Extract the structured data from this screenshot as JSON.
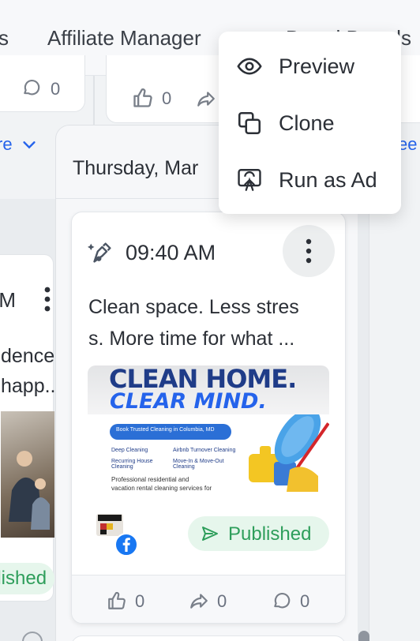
{
  "nav": {
    "left_fragment": "s",
    "affiliate_manager": "Affiliate Manager",
    "right_fragment": "Brand Boards"
  },
  "left_card": {
    "comment_count": "0",
    "see_more_fragment": "re",
    "time_fragment": "AM",
    "text_line1": "dence",
    "text_line2": "happ...",
    "status_fragment": "blished"
  },
  "middle_card": {
    "like_count": "0"
  },
  "right_fragment": "ee",
  "column": {
    "date_header": "Thursday, Mar"
  },
  "post": {
    "time": "09:40 AM",
    "caption_line1": "Clean space. Less stres",
    "caption_line2": "s. More time for what ...",
    "status": "Published",
    "like_count": "0",
    "share_count": "0",
    "comment_count": "0",
    "image": {
      "headline1": "CLEAN HOME.",
      "headline2": "CLEAR MIND.",
      "banner": "Book Trusted Cleaning in Columbia, MD",
      "services": [
        "Deep Cleaning",
        "Airbnb Turnover Cleaning",
        "Recurring House Cleaning",
        "Move-In & Move-Out Cleaning"
      ],
      "footer_line1": "Professional residential and",
      "footer_line2": "vacation rental cleaning services for"
    }
  },
  "menu": {
    "items": [
      {
        "label": "Preview",
        "icon": "eye-icon"
      },
      {
        "label": "Clone",
        "icon": "clone-icon"
      },
      {
        "label": "Run as Ad",
        "icon": "ad-icon"
      }
    ]
  },
  "colors": {
    "accent_blue": "#2563eb",
    "published_bg": "#e6f6ec",
    "published_text": "#2e9e5b",
    "facebook": "#1877f2"
  }
}
